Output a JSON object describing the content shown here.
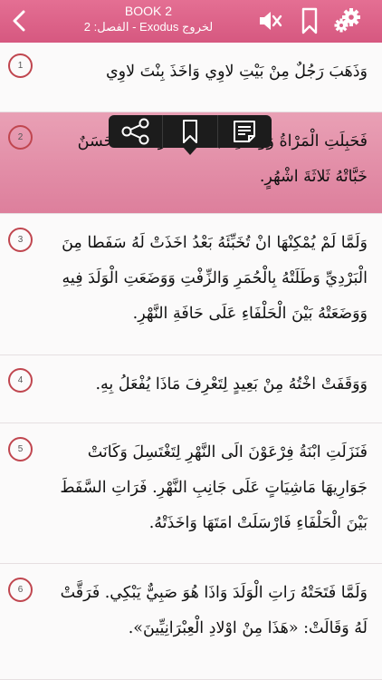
{
  "header": {
    "book_label": "BOOK 2",
    "chapter_label": "لخروج Exodus - الفصل: 2",
    "icons": [
      "chevron-left-icon",
      "mute-speaker-icon",
      "bookmark-icon",
      "gear-icon"
    ],
    "color": "#d95f86"
  },
  "verses": [
    {
      "num": "1",
      "text": "وَذَهَبَ رَجُلٌ مِنْ بَيْتِ لاوِي وَاخَذَ بِنْتَ لاوِي"
    },
    {
      "num": "2",
      "text": "فَحَبِلَتِ الْمَرْاةُ وَوَلَدَتِ ابْنا. وَلَمَّا رَاتْهُ انَّهُ حَسَنٌ خَبَّاتْهُ ثَلاثَةَ اشْهُرٍ."
    },
    {
      "num": "3",
      "text": "وَلَمَّا لَمْ يُمْكِنْهَا انْ تُخَبِّئَهُ بَعْدُ اخَذَتْ لَهُ سَفَطا مِنَ الْبَرْدِيِّ وَطَلَتْهُ بِالْحُمَرِ وَالزِّفْتِ وَوَضَعَتِ الْوَلَدَ فِيهِ وَوَضَعَتْهُ بَيْنَ الْحَلْفَاءِ عَلَى حَافَةِ النَّهْرِ."
    },
    {
      "num": "4",
      "text": "وَوَقَفَتْ اخْتُهُ مِنْ بَعِيدٍ لِتَعْرِفَ مَاذَا يُفْعَلُ بِهِ."
    },
    {
      "num": "5",
      "text": "فَنَزَلَتِ ابْنَةُ فِرْعَوْنَ الَى النَّهْرِ لِتَغْتَسِلَ وَكَانَتْ جَوَارِيهَا مَاشِيَاتٍ عَلَى جَانِبِ النَّهْرِ. فَرَاتِ السَّفَطَ بَيْنَ الْحَلْفَاءِ فَارْسَلَتْ امَتَهَا وَاخَذَتْهُ."
    },
    {
      "num": "6",
      "text": "وَلَمَّا فَتَحَتْهُ رَاتِ الْوَلَدَ وَاذَا هُوَ صَبِيٌّ يَبْكِي. فَرَقَّتْ لَهُ وَقَالَتْ: «هَذَا مِنْ اوْلادِ الْعِبْرَانِيِّينَ»."
    }
  ],
  "popup": {
    "icons": [
      "share-icon",
      "bookmark-icon",
      "note-icon"
    ]
  },
  "colors": {
    "accent": "#d95f86",
    "selected_row": "#e58ea8",
    "verse_circle": "#c0464f"
  }
}
